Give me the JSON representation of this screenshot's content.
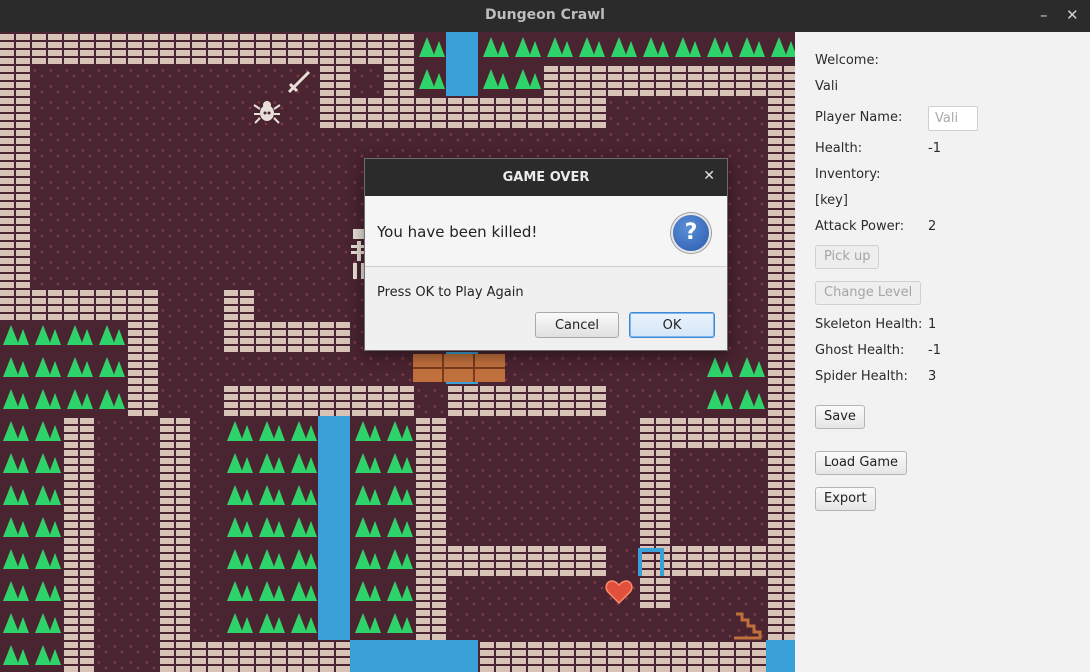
{
  "window": {
    "title": "Dungeon Crawl"
  },
  "colors": {
    "floor": "#4a2430",
    "wall": "#d8c3b6",
    "tree": "#2fd36a",
    "water": "#3aa0d8",
    "sidebar_bg": "#f2f2f2"
  },
  "map": {
    "cols": 25,
    "rows": 20,
    "legend": {
      "W": "wall",
      "T": "tree",
      "~": "water",
      ".": "floor"
    },
    "grid": [
      "WWWWWWWWWWWWWT~TTTTTTTTTT",
      "W.........W.WT~TTWWWWWWWW",
      "W.........WWWWWWWWW.....W",
      "W.......................W",
      "W.......................W",
      "W.......................W",
      "W.......................W",
      "W.......................W",
      "WWWWW..W................W",
      "TTTTW..WWWW.............W",
      "TTTTW.........~.......TTW",
      "TTTTW..WWWWWW.WWWWW...TTW",
      "TTW..W.TTT~TTW......WWWWW",
      "TTW..W.TTT~TTW......W...W",
      "TTW..W.TTT~TTW......W...W",
      "TTW..W.TTT~TTW......W...W",
      "TTW..W.TTT~TTWWWWWW.WWWWW",
      "TTW..W.TTT~TTW......W...W",
      "TTW..W.TTT~TTW..........W",
      "TTW..WWWWWW~~~~WWWWWWWWW~"
    ],
    "sprites": [
      {
        "name": "sword-icon",
        "glyph": "⚔"
      },
      {
        "name": "spider-icon",
        "glyph": "🕷"
      },
      {
        "name": "skeleton-icon",
        "glyph": "☠"
      },
      {
        "name": "bridge-icon",
        "glyph": ""
      },
      {
        "name": "door-icon",
        "glyph": ""
      },
      {
        "name": "heart-icon",
        "glyph": "♥"
      },
      {
        "name": "stairs-icon",
        "glyph": ""
      }
    ]
  },
  "sidebar": {
    "welcome_label": "Welcome:",
    "welcome_name": "Vali",
    "player_name_label": "Player Name:",
    "player_name_placeholder": "Vali",
    "health_label": "Health:",
    "health_value": "-1",
    "inventory_label": "Inventory:",
    "inventory_value": "[key]",
    "attack_label": "Attack Power:",
    "attack_value": "2",
    "pickup_button": "Pick up",
    "change_level_button": "Change Level",
    "skeleton_label": "Skeleton Health:",
    "skeleton_value": "1",
    "ghost_label": "Ghost Health:",
    "ghost_value": "-1",
    "spider_label": "Spider Health:",
    "spider_value": "3",
    "save_button": "Save",
    "load_button": "Load Game",
    "export_button": "Export"
  },
  "dialog": {
    "title": "GAME OVER",
    "header": "You have been killed!",
    "content": "Press OK to Play Again",
    "cancel": "Cancel",
    "ok": "OK"
  }
}
